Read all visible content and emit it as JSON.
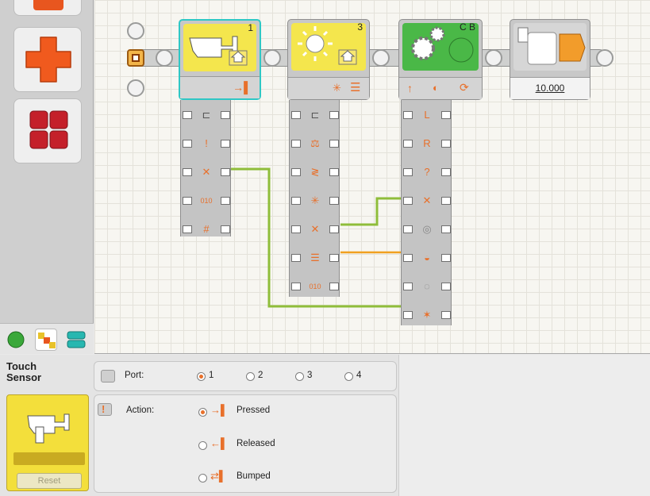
{
  "blocks": [
    {
      "id": "touch",
      "number": "1"
    },
    {
      "id": "light",
      "number": "3"
    },
    {
      "id": "motor",
      "number": "C B"
    },
    {
      "id": "wait",
      "number": "",
      "value": "10.000"
    }
  ],
  "panel": {
    "title_line1": "Touch",
    "title_line2": "Sensor",
    "reset_label": "Reset",
    "port_label": "Port:",
    "ports": [
      "1",
      "2",
      "3",
      "4"
    ],
    "selected_port": "1",
    "action_label": "Action:",
    "actions": [
      "Pressed",
      "Released",
      "Bumped"
    ],
    "selected_action": "Pressed"
  },
  "colors": {
    "accent": "#e8702b",
    "selection": "#2ec7c5",
    "sensor_yellow": "#f3df3b",
    "wire_green": "#8fbd3a",
    "wire_orange": "#f0a020"
  }
}
